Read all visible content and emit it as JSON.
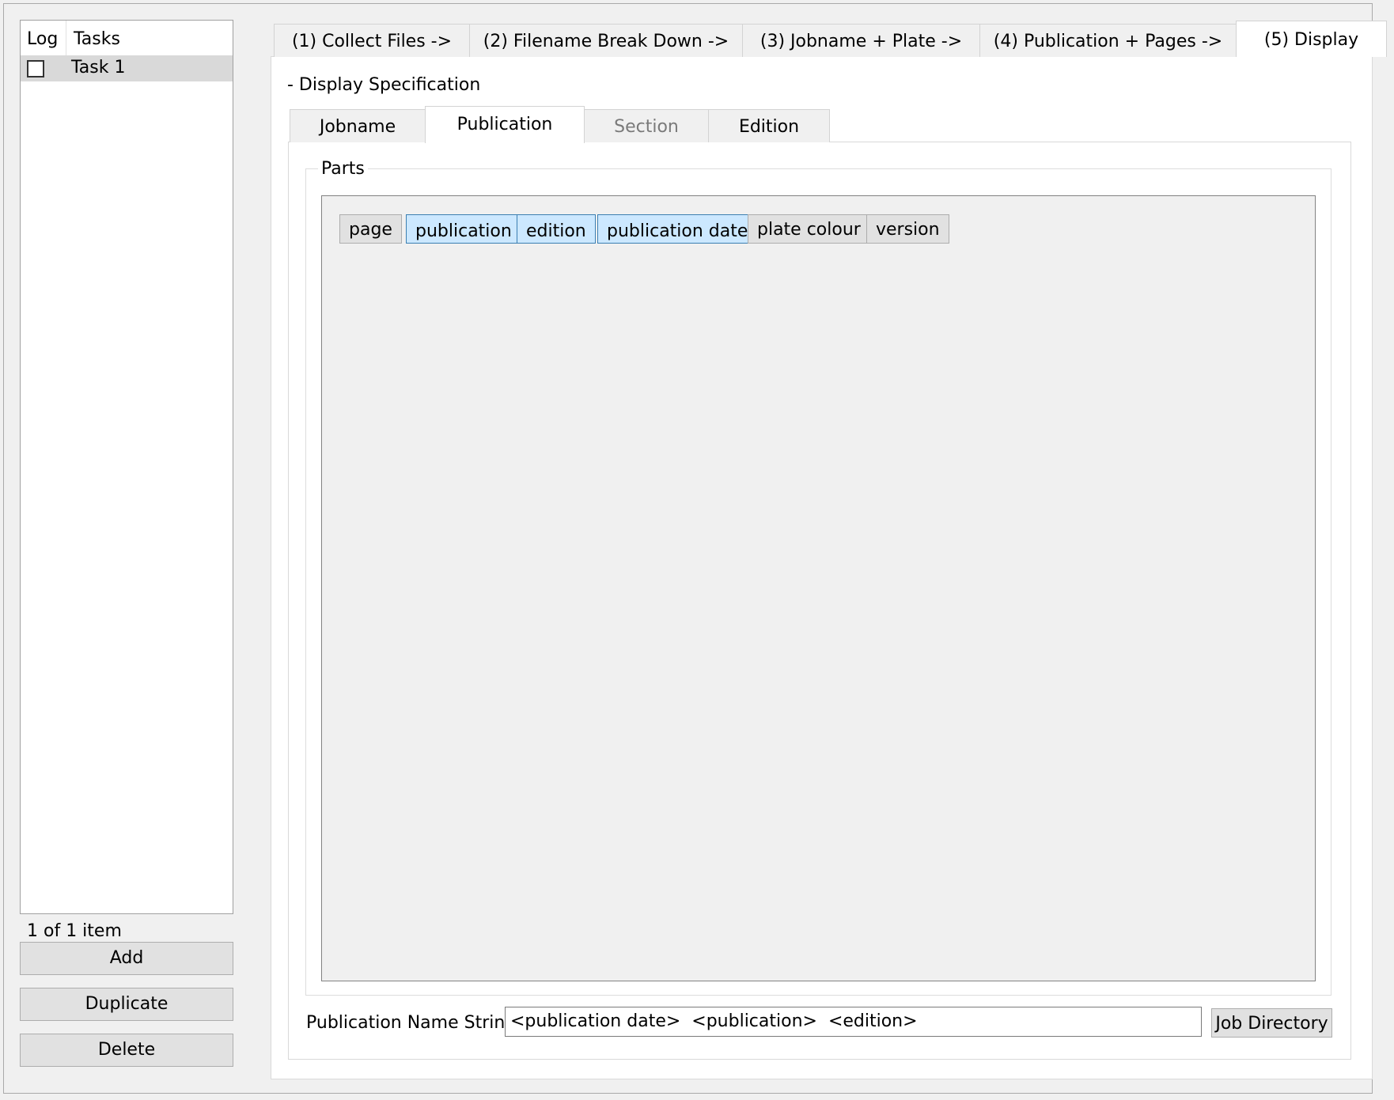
{
  "sidebar": {
    "headers": {
      "log": "Log",
      "tasks": "Tasks"
    },
    "tasks": [
      {
        "label": "Task 1",
        "checked": false
      }
    ],
    "count_text": "1 of 1 item",
    "buttons": {
      "add": "Add",
      "duplicate": "Duplicate",
      "delete": "Delete"
    }
  },
  "main_tabs": [
    {
      "label": "(1) Collect Files ->"
    },
    {
      "label": "(2) Filename Break Down ->"
    },
    {
      "label": "(3) Jobname + Plate ->"
    },
    {
      "label": "(4) Publication + Pages ->"
    },
    {
      "label": "(5) Display",
      "active": true
    }
  ],
  "display": {
    "title": "- Display Specification",
    "sub_tabs": [
      {
        "label": "Jobname"
      },
      {
        "label": "Publication",
        "active": true
      },
      {
        "label": "Section",
        "disabled": true
      },
      {
        "label": "Edition"
      }
    ],
    "parts_label": "Parts",
    "parts": [
      {
        "label": "page",
        "selected": false
      },
      {
        "label": "publication",
        "selected": true
      },
      {
        "label": "edition",
        "selected": true
      },
      {
        "label": "publication date",
        "selected": true
      },
      {
        "label": "plate colour",
        "selected": false
      },
      {
        "label": "version",
        "selected": false
      }
    ],
    "name_string_label": "Publication Name String:",
    "name_string_value": "<publication date>  <publication>  <edition>",
    "job_directory_button": "Job Directory"
  },
  "colors": {
    "selected_chip": "#cce8ff",
    "selected_chip_border": "#3c7fb1",
    "selected_row": "#d9d9d9"
  }
}
